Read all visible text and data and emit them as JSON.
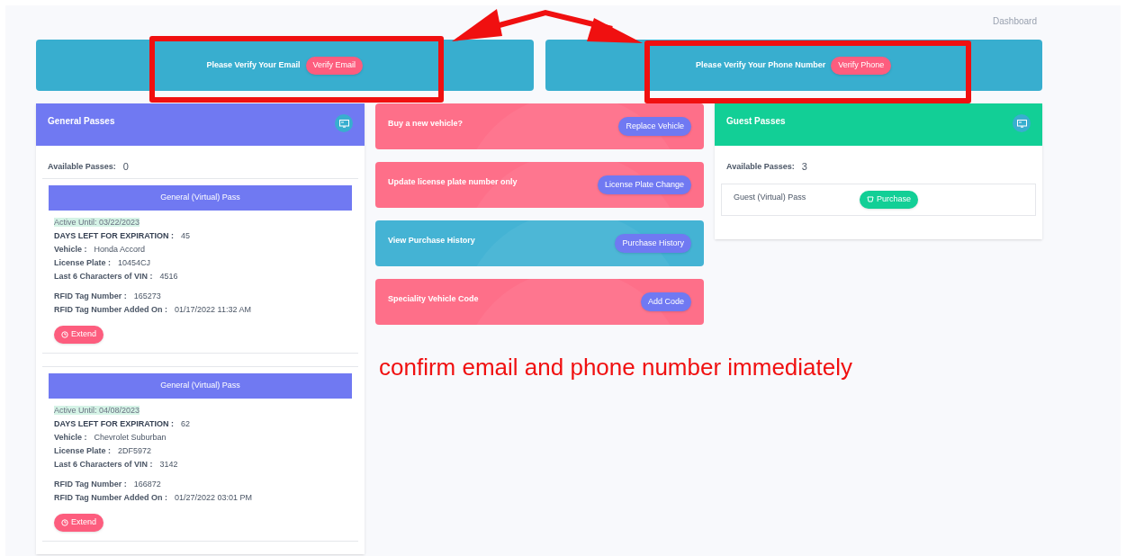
{
  "breadcrumb": "Dashboard",
  "banners": [
    {
      "message": "Please Verify Your Email",
      "button": "Verify Email"
    },
    {
      "message": "Please Verify Your Phone Number",
      "button": "Verify Phone"
    }
  ],
  "general_passes": {
    "title": "General Passes",
    "available_label": "Available Passes:",
    "available_count": "0",
    "passes": [
      {
        "header": "General (Virtual) Pass",
        "active_until": "Active Until: 03/22/2023",
        "fields": [
          {
            "label": "DAYS LEFT FOR EXPIRATION :",
            "value": "45",
            "kind": "strong"
          },
          {
            "label": "Vehicle :",
            "value": "Honda Accord",
            "kind": "plain"
          },
          {
            "label": "License Plate :",
            "value": "10454CJ",
            "kind": "plain"
          },
          {
            "label": "Last 6 Characters of VIN :",
            "value": "4516",
            "kind": "plain"
          }
        ],
        "rfid": [
          {
            "label": "RFID Tag Number :",
            "value": "165273"
          },
          {
            "label": "RFID Tag Number Added On :",
            "value": "01/17/2022 11:32 AM"
          }
        ],
        "button": "Extend"
      },
      {
        "header": "General (Virtual) Pass",
        "active_until": "Active Until: 04/08/2023",
        "fields": [
          {
            "label": "DAYS LEFT FOR EXPIRATION :",
            "value": "62",
            "kind": "strong"
          },
          {
            "label": "Vehicle :",
            "value": "Chevrolet Suburban",
            "kind": "plain"
          },
          {
            "label": "License Plate :",
            "value": "2DF5972",
            "kind": "plain"
          },
          {
            "label": "Last 6 Characters of VIN :",
            "value": "3142",
            "kind": "plain"
          }
        ],
        "rfid": [
          {
            "label": "RFID Tag Number :",
            "value": "166872"
          },
          {
            "label": "RFID Tag Number Added On :",
            "value": "01/27/2022 03:01 PM"
          }
        ],
        "button": "Extend"
      }
    ]
  },
  "actions": [
    {
      "text": "Buy a new vehicle?",
      "button": "Replace Vehicle",
      "kind": "pink"
    },
    {
      "text": "Update license plate number only",
      "button": "License Plate Change",
      "kind": "pink"
    },
    {
      "text": "View Purchase History",
      "button": "Purchase History",
      "kind": "blue"
    },
    {
      "text": "Speciality Vehicle Code",
      "button": "Add Code",
      "kind": "pink"
    }
  ],
  "guest_passes": {
    "title": "Guest Passes",
    "available_label": "Available Passes:",
    "available_count": "3",
    "items": [
      {
        "name": "Guest (Virtual) Pass",
        "button": "Purchase"
      }
    ]
  },
  "annotation": {
    "note": "confirm email and phone number immediately"
  }
}
